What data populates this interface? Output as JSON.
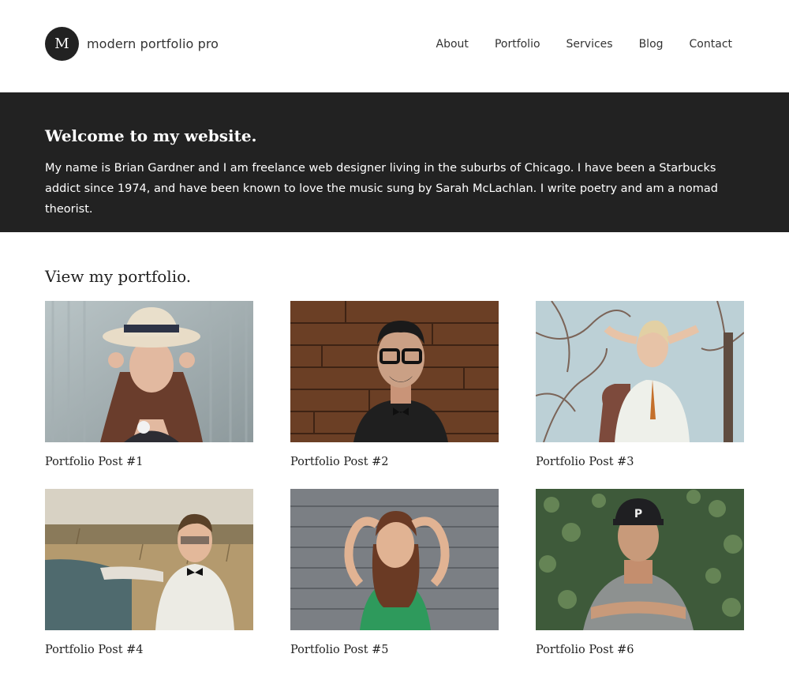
{
  "header": {
    "logo_letter": "M",
    "site_title": "modern portfolio pro",
    "nav": [
      "About",
      "Portfolio",
      "Services",
      "Blog",
      "Contact"
    ]
  },
  "hero": {
    "title": "Welcome to my website.",
    "text": "My name is Brian Gardner and I am freelance web designer living in the suburbs of Chicago. I have been a Starbucks addict since 1974, and have been known to love the music sung by Sarah McLachlan. I write poetry and am a nomad theorist."
  },
  "portfolio": {
    "heading": "View my portfolio.",
    "posts": [
      {
        "title": "Portfolio Post #1"
      },
      {
        "title": "Portfolio Post #2"
      },
      {
        "title": "Portfolio Post #3"
      },
      {
        "title": "Portfolio Post #4"
      },
      {
        "title": "Portfolio Post #5"
      },
      {
        "title": "Portfolio Post #6"
      }
    ]
  },
  "colors": {
    "hero_bg": "#222222",
    "text": "#222222",
    "background": "#ffffff"
  }
}
